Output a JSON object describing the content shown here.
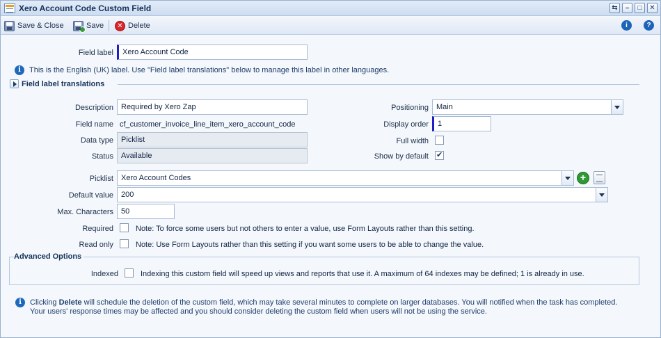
{
  "window": {
    "title": "Xero Account Code Custom Field",
    "buttons": {
      "pin": "⇆",
      "minimize": "–",
      "maximize": "□",
      "close": "✕"
    }
  },
  "toolbar": {
    "save_close_label": "Save & Close",
    "save_label": "Save",
    "delete_label": "Delete",
    "info_glyph": "i",
    "help_glyph": "?"
  },
  "form": {
    "field_label": {
      "label": "Field label",
      "value": "Xero Account Code"
    },
    "label_note": "This is the English (UK) label. Use \"Field label translations\" below to manage this label in other languages.",
    "translations_title": "Field label translations",
    "description": {
      "label": "Description",
      "value": "Required by Xero Zap"
    },
    "field_name": {
      "label": "Field name",
      "value": "cf_customer_invoice_line_item_xero_account_code"
    },
    "data_type": {
      "label": "Data type",
      "value": "Picklist"
    },
    "status": {
      "label": "Status",
      "value": "Available"
    },
    "positioning": {
      "label": "Positioning",
      "value": "Main"
    },
    "display_order": {
      "label": "Display order",
      "value": "1"
    },
    "full_width": {
      "label": "Full width",
      "checked": false
    },
    "show_by_default": {
      "label": "Show by default",
      "checked": true
    },
    "picklist": {
      "label": "Picklist",
      "value": "Xero Account Codes"
    },
    "default_value": {
      "label": "Default value",
      "value": "200"
    },
    "max_characters": {
      "label": "Max. Characters",
      "value": "50"
    },
    "required": {
      "label": "Required",
      "checked": false,
      "note": "Note: To force some users but not others to enter a value, use Form Layouts rather than this setting."
    },
    "read_only": {
      "label": "Read only",
      "checked": false,
      "note": "Note: Use Form Layouts rather than this setting if you want some users to be able to change the value."
    },
    "advanced_title": "Advanced Options",
    "indexed": {
      "label": "Indexed",
      "checked": false,
      "note": "Indexing this custom field will speed up views and reports that use it. A maximum of 64 indexes may be defined; 1 is already in use."
    },
    "delete_note": {
      "prefix": "Clicking ",
      "keyword": "Delete",
      "suffix": " will schedule the deletion of the custom field, which may take several minutes to complete on larger databases. You will notified when the task has completed.",
      "line2": "Your users' response times may be affected and you should consider deleting the custom field when users will not be using the service."
    }
  },
  "icons": {
    "info": "info-icon",
    "help": "help-icon",
    "save": "floppy-disk-icon",
    "delete": "delete-icon",
    "add": "plus-icon",
    "list": "list-icon"
  },
  "colors": {
    "titlebar": "#cddcf0",
    "accent_focus": "#1e1ec4",
    "info_blue": "#1f69bd",
    "delete_red": "#d8262a",
    "add_green": "#2e9a34"
  }
}
